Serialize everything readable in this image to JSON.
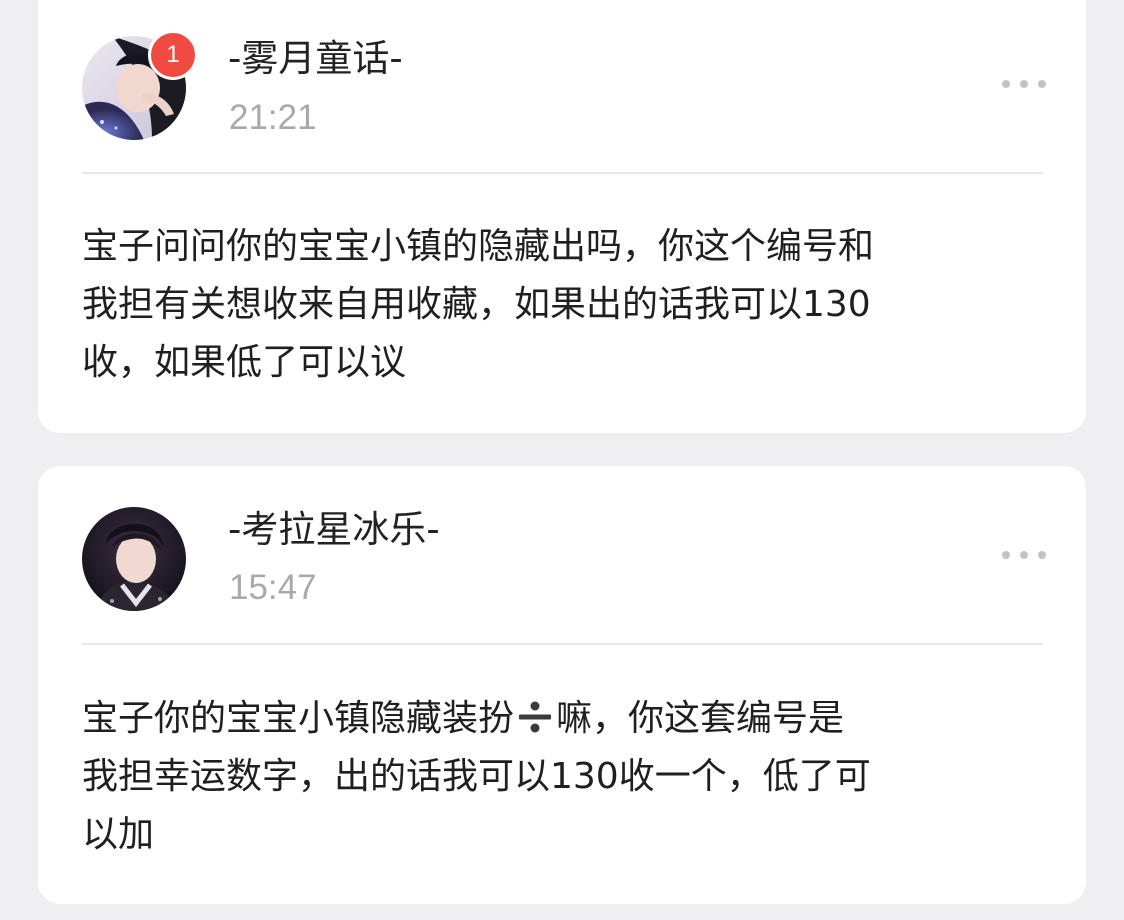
{
  "posts": [
    {
      "username": "-雾月童话-",
      "time": "21:21",
      "badge_count": "1",
      "text": "宝子问问你的宝宝小镇的隐藏出吗，你这个编号和\n我担有关想收来自用收藏，如果出的话我可以130\n收，如果低了可以议"
    },
    {
      "username": "-考拉星冰乐-",
      "time": "15:47",
      "text_before_icon": "宝子你的宝宝小镇隐藏装扮",
      "inline_icon": "divide-icon",
      "text_after_icon": "嘛，你这套编号是\n我担幸运数字，出的话我可以130收一个，低了可\n以加"
    }
  ],
  "icons": {
    "more": "more-horizontal-icon",
    "badge_color": "#f14a41"
  }
}
